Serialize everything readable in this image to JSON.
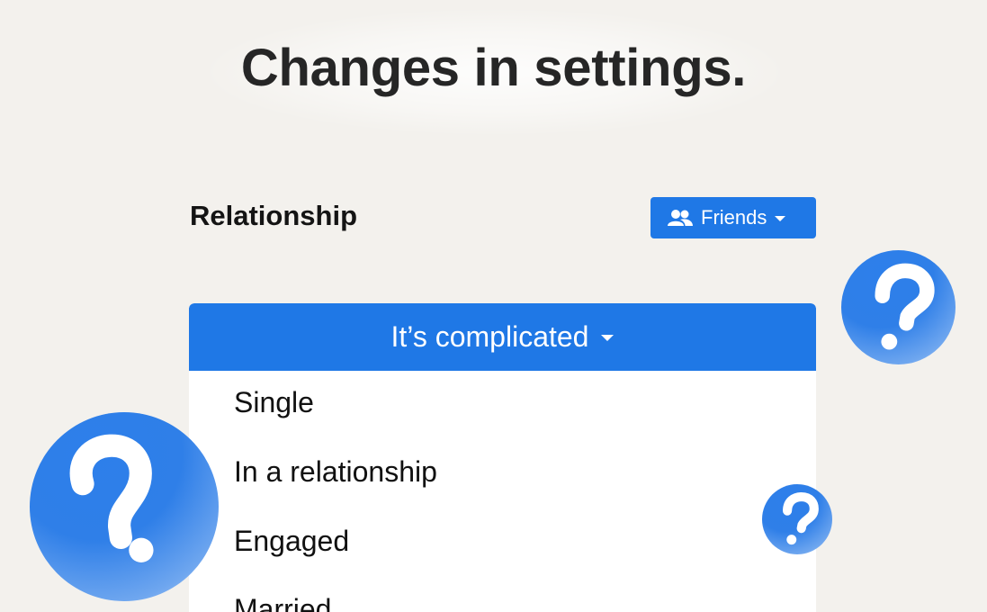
{
  "headline": "Changes in settings.",
  "relationship_label": "Relationship",
  "privacy_button": {
    "label": "Friends",
    "icon": "users-icon"
  },
  "status_dropdown": {
    "selected": "It’s complicated",
    "options": [
      "Single",
      "In a relationship",
      "Engaged",
      "Married"
    ]
  },
  "colors": {
    "accent": "#1f78e6",
    "background": "#f3f1ed",
    "text": "#262626"
  },
  "decorations": [
    "question-bubble-icon",
    "question-bubble-icon",
    "question-bubble-icon"
  ]
}
